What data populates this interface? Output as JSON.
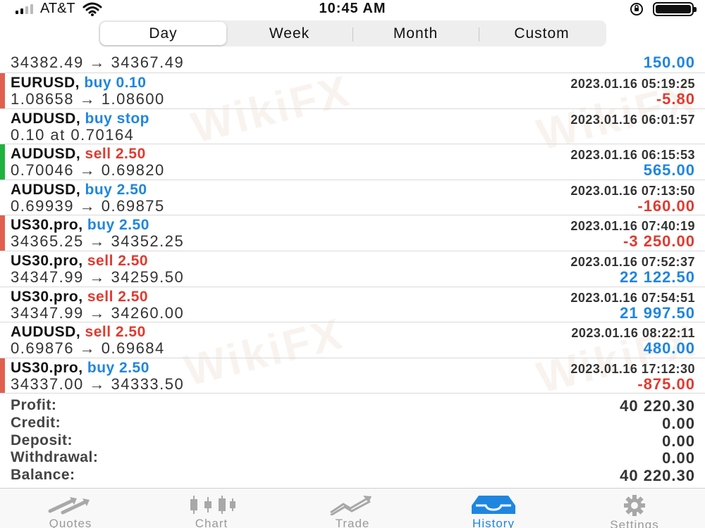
{
  "status_bar": {
    "carrier": "AT&T",
    "time": "10:45 AM"
  },
  "periods": {
    "tabs": [
      "Day",
      "Week",
      "Month",
      "Custom"
    ],
    "selected": "Day"
  },
  "colors": {
    "buy": "#1f86e0",
    "sell": "#e03b30",
    "profit_positive": "#1f86e0",
    "profit_negative": "#e03b30",
    "bar_loss": "#e0604f",
    "bar_win": "#20b23e"
  },
  "history": {
    "partial_row": {
      "prices": "34382.49 → 34367.49",
      "profit": "150.00"
    },
    "rows": [
      {
        "symbol": "EURUSD,",
        "action": "buy 0.10",
        "side": "buy",
        "prices": "1.08658 → 1.08600",
        "time": "2023.01.16 05:19:25",
        "profit": "-5.80",
        "bar": "loss"
      },
      {
        "symbol": "AUDUSD,",
        "action": "buy stop",
        "side": "buy",
        "prices": "0.10 at 0.70164",
        "time": "2023.01.16 06:01:57",
        "profit": "",
        "bar": "none"
      },
      {
        "symbol": "AUDUSD,",
        "action": "sell 2.50",
        "side": "sell",
        "prices": "0.70046 → 0.69820",
        "time": "2023.01.16 06:15:53",
        "profit": "565.00",
        "bar": "win"
      },
      {
        "symbol": "AUDUSD,",
        "action": "buy 2.50",
        "side": "buy",
        "prices": "0.69939 → 0.69875",
        "time": "2023.01.16 07:13:50",
        "profit": "-160.00",
        "bar": "none"
      },
      {
        "symbol": "US30.pro,",
        "action": "buy 2.50",
        "side": "buy",
        "prices": "34365.25 → 34352.25",
        "time": "2023.01.16 07:40:19",
        "profit": "-3 250.00",
        "bar": "loss"
      },
      {
        "symbol": "US30.pro,",
        "action": "sell 2.50",
        "side": "sell",
        "prices": "34347.99 → 34259.50",
        "time": "2023.01.16 07:52:37",
        "profit": "22 122.50",
        "bar": "none"
      },
      {
        "symbol": "US30.pro,",
        "action": "sell 2.50",
        "side": "sell",
        "prices": "34347.99 → 34260.00",
        "time": "2023.01.16 07:54:51",
        "profit": "21 997.50",
        "bar": "none"
      },
      {
        "symbol": "AUDUSD,",
        "action": "sell 2.50",
        "side": "sell",
        "prices": "0.69876 → 0.69684",
        "time": "2023.01.16 08:22:11",
        "profit": "480.00",
        "bar": "none"
      },
      {
        "symbol": "US30.pro,",
        "action": "buy 2.50",
        "side": "buy",
        "prices": "34337.00 → 34333.50",
        "time": "2023.01.16 17:12:30",
        "profit": "-875.00",
        "bar": "loss"
      }
    ]
  },
  "summary": [
    {
      "label": "Profit:",
      "value": "40 220.30"
    },
    {
      "label": "Credit:",
      "value": "0.00"
    },
    {
      "label": "Deposit:",
      "value": "0.00"
    },
    {
      "label": "Withdrawal:",
      "value": "0.00"
    },
    {
      "label": "Balance:",
      "value": "40 220.30"
    }
  ],
  "tabbar": {
    "items": [
      {
        "label": "Quotes",
        "icon": "quotes-arrows-icon"
      },
      {
        "label": "Chart",
        "icon": "candlestick-icon"
      },
      {
        "label": "Trade",
        "icon": "trade-trend-icon"
      },
      {
        "label": "History",
        "icon": "history-inbox-icon"
      },
      {
        "label": "Settings",
        "icon": "gear-icon"
      }
    ],
    "active": "History"
  },
  "watermark": "WikiFX"
}
